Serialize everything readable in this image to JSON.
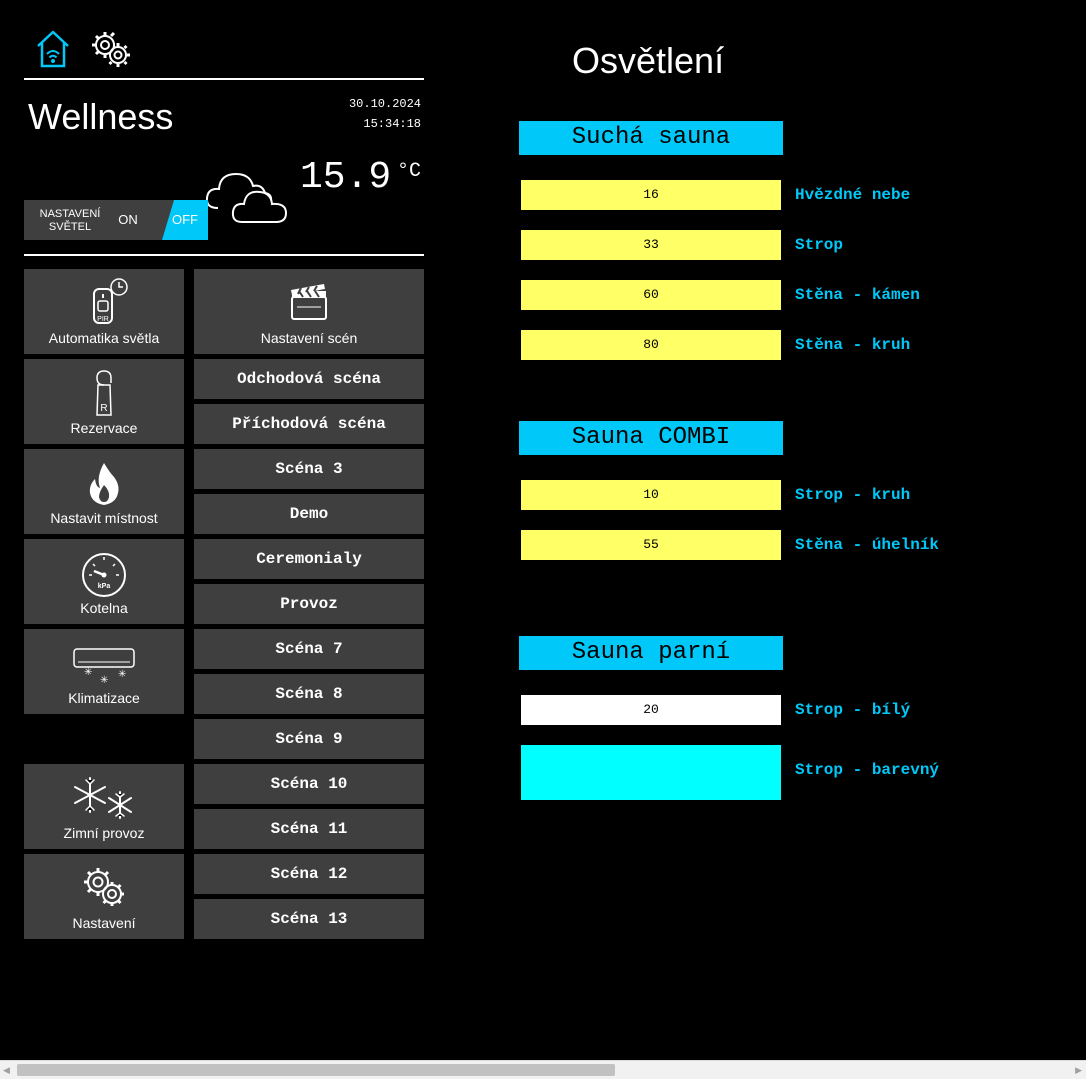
{
  "header": {
    "home_icon": "home-wifi-icon",
    "settings_icon": "gears-icon",
    "title": "Wellness",
    "date": "30.10.2024",
    "time": "15:34:18",
    "weather_icon": "cloud-icon",
    "temperature": "15.9",
    "temperature_unit": "°C"
  },
  "lights_toggle": {
    "label_line1": "NASTAVENÍ",
    "label_line2": "SVĚTEL",
    "on_label": "ON",
    "off_label": "OFF",
    "state": "OFF"
  },
  "left_tiles": [
    {
      "label": "Automatika světla",
      "icon": "pir-clock-icon"
    },
    {
      "label": "Rezervace",
      "icon": "door-hanger-icon"
    },
    {
      "label": "Nastavit místnost",
      "icon": "flame-icon"
    },
    {
      "label": "Kotelna",
      "icon": "pressure-gauge-icon"
    },
    {
      "label": "Klimatizace",
      "icon": "air-conditioner-icon"
    },
    {
      "label": "Zimní provoz",
      "icon": "snowflake-icon"
    },
    {
      "label": "Nastavení",
      "icon": "gears-icon"
    }
  ],
  "scene_settings": {
    "label": "Nastavení scén",
    "icon": "clapperboard-icon"
  },
  "scenes": [
    "Odchodová scéna",
    "Příchodová scéna",
    "Scéna 3",
    "Demo",
    "Ceremonialy",
    "Provoz",
    "Scéna 7",
    "Scéna 8",
    "Scéna 9",
    "Scéna 10",
    "Scéna 11",
    "Scéna 12",
    "Scéna 13"
  ],
  "main": {
    "title": "Osvětlení",
    "sections": [
      {
        "name": "Suchá sauna",
        "lights": [
          {
            "value": "16",
            "label": "Hvězdné nebe",
            "color": "#ffff66"
          },
          {
            "value": "33",
            "label": "Strop",
            "color": "#ffff66"
          },
          {
            "value": "60",
            "label": "Stěna - kámen",
            "color": "#ffff66"
          },
          {
            "value": "80",
            "label": "Stěna - kruh",
            "color": "#ffff66"
          }
        ]
      },
      {
        "name": "Sauna COMBI",
        "lights": [
          {
            "value": "10",
            "label": "Strop - kruh",
            "color": "#ffff66"
          },
          {
            "value": "55",
            "label": "Stěna - úhelník",
            "color": "#ffff66"
          }
        ]
      },
      {
        "name": "Sauna parní",
        "lights": [
          {
            "value": "20",
            "label": "Strop - bílý",
            "color": "#ffffff"
          },
          {
            "value": "",
            "label": "Strop - barevný",
            "color": "#00ffff"
          }
        ]
      }
    ]
  },
  "colors": {
    "accent": "#00c8f8",
    "tile_bg": "#3f3f3f",
    "value_bg": "#ffff66",
    "background": "#000000"
  }
}
